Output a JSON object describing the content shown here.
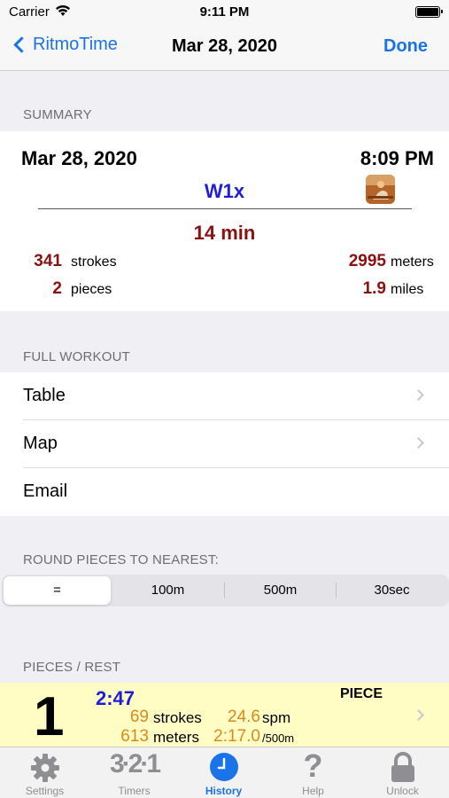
{
  "status": {
    "carrier": "Carrier",
    "time": "9:11 PM"
  },
  "nav": {
    "back_label": "RitmoTime",
    "title": "Mar 28, 2020",
    "done_label": "Done"
  },
  "summary": {
    "header": "SUMMARY",
    "date": "Mar 28, 2020",
    "time": "8:09 PM",
    "boat": "W1x",
    "duration": "14 min",
    "strokes_value": "341",
    "strokes_label": "strokes",
    "pieces_value": "2",
    "pieces_label": "pieces",
    "meters_value": "2995",
    "meters_label": "meters",
    "miles_value": "1.9",
    "miles_label": "miles"
  },
  "full_workout": {
    "header": "FULL WORKOUT",
    "items": [
      {
        "label": "Table"
      },
      {
        "label": "Map"
      },
      {
        "label": "Email"
      }
    ]
  },
  "rounding": {
    "header": "ROUND PIECES TO NEAREST:",
    "options": [
      "=",
      "100m",
      "500m",
      "30sec"
    ],
    "selected": "="
  },
  "pieces": {
    "header": "PIECES / REST",
    "rows": [
      {
        "number": "1",
        "time": "2:47",
        "type": "PIECE",
        "strokes_value": "69",
        "strokes_label": "strokes",
        "spm_value": "24.6",
        "spm_label": "spm",
        "meters_value": "613",
        "meters_label": "meters",
        "split_value": "2:17.0",
        "split_label": "/500m"
      }
    ]
  },
  "tabs": [
    {
      "label": "Settings",
      "icon": "gear-icon"
    },
    {
      "label": "Timers",
      "icon": "countdown-icon"
    },
    {
      "label": "History",
      "icon": "clock-icon",
      "active": true
    },
    {
      "label": "Help",
      "icon": "question-icon"
    },
    {
      "label": "Unlock",
      "icon": "lock-icon"
    }
  ],
  "colors": {
    "accent": "#1a73e8",
    "dark_red": "#8b1010",
    "boat_blue": "#1f1fd8",
    "orange": "#d98a1e",
    "piece_bg": "#fffdc4"
  }
}
